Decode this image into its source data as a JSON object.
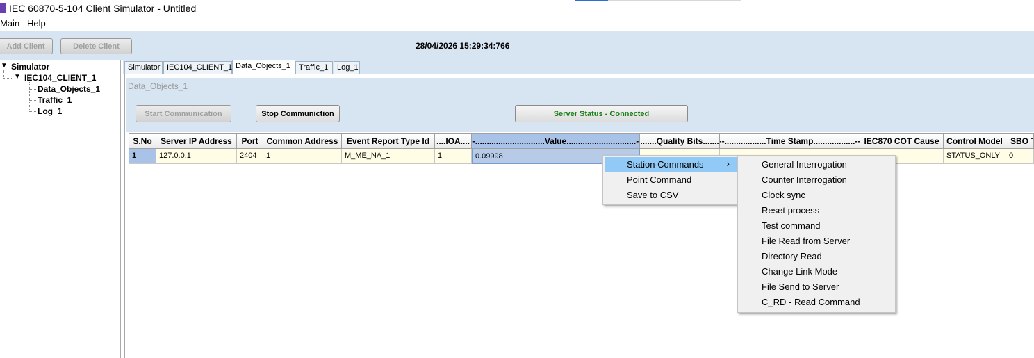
{
  "window": {
    "title": "IEC 60870-5-104 Client Simulator - Untitled"
  },
  "menu": {
    "items": [
      "Main",
      "Help"
    ]
  },
  "toolbar": {
    "add_client": "Add Client",
    "delete_client": "Delete Client",
    "datetime": "28/04/2026 15:29:34:766"
  },
  "tree": {
    "root": "Simulator",
    "client": "IEC104_CLIENT_1",
    "children": [
      "Data_Objects_1",
      "Traffic_1",
      "Log_1"
    ]
  },
  "tabs": [
    "Simulator",
    "IEC104_CLIENT_1",
    "Data_Objects_1",
    "Traffic_1",
    "Log_1"
  ],
  "active_tab": "Data_Objects_1",
  "panel": {
    "title": "Data_Objects_1",
    "start_label": "Start Communication",
    "stop_label": "Stop Communiction",
    "status_label": "Server Status - Connected",
    "status_color": "#1a7f1a"
  },
  "table": {
    "headers": [
      "S.No",
      "Server IP Address",
      "Port",
      "Common Address",
      "Event Report Type Id",
      "....IOA....",
      "---..............................Value..............................---",
      ".......Quality Bits.......",
      "---..................Time Stamp..................---",
      "IEC870 COT Cause",
      "Control Model",
      "SBO Ti"
    ],
    "row": [
      "1",
      "127.0.0.1",
      "2404",
      "1",
      "M_ME_NA_1",
      "1",
      "0.09998",
      "",
      "",
      "",
      "STATUS_ONLY",
      "0"
    ]
  },
  "context_menu": {
    "items": [
      "Station Commands",
      "Point Command",
      "Save to CSV"
    ],
    "submenu_arrow": "›"
  },
  "submenu": {
    "items": [
      "General Interrogation",
      "Counter Interrogation",
      "Clock sync",
      "Reset process",
      "Test command",
      "File Read from Server",
      "Directory Read",
      "Change Link Mode",
      "File Send to Server",
      "C_RD - Read Command"
    ]
  }
}
